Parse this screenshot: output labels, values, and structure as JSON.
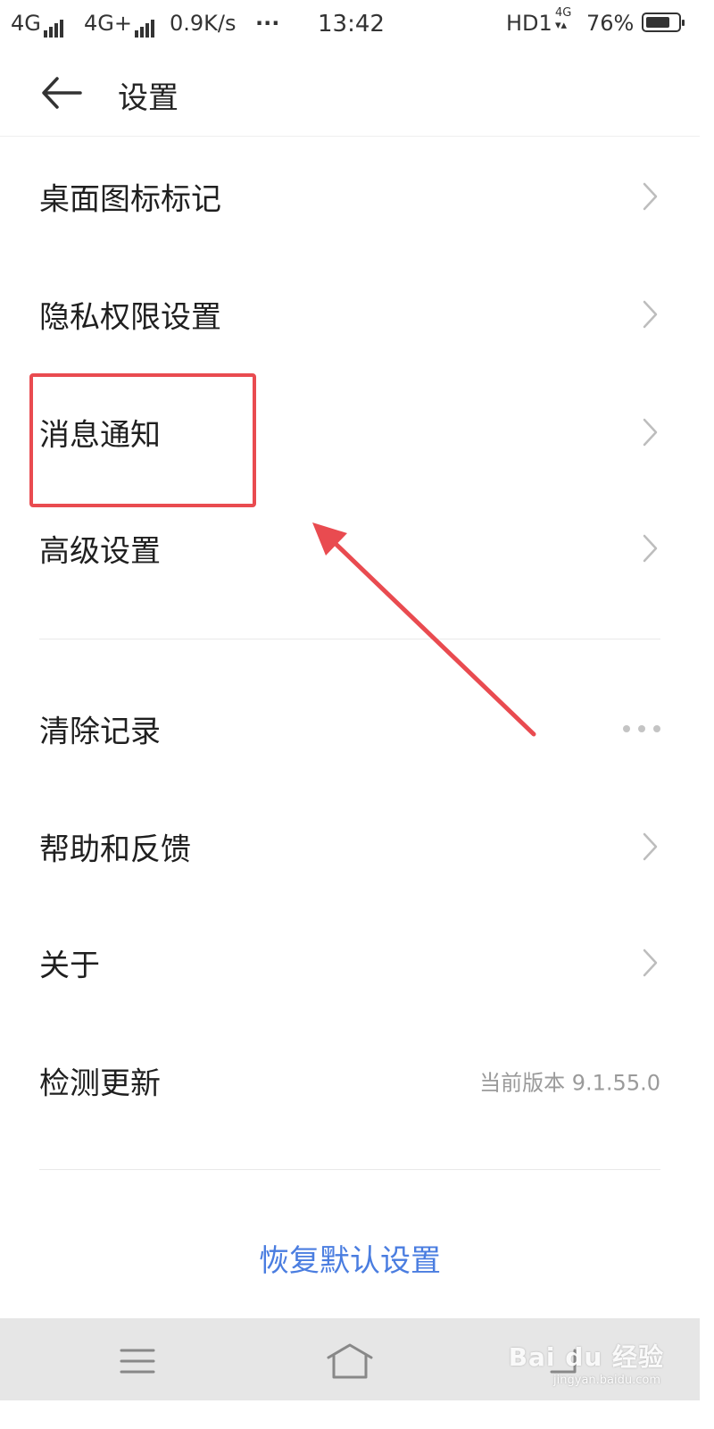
{
  "status_bar": {
    "network1": "4G",
    "network2": "4G+",
    "speed": "0.9K/s",
    "more": "···",
    "time": "13:42",
    "hd": "HD1",
    "lte": "4G",
    "battery": "76%",
    "battery_level": 0.76
  },
  "header": {
    "title": "设置"
  },
  "settings": {
    "desktop_badge": "桌面图标标记",
    "privacy": "隐私权限设置",
    "notifications": "消息通知",
    "advanced": "高级设置",
    "clear_records": "清除记录",
    "help_feedback": "帮助和反馈",
    "about": "关于",
    "check_update": "检测更新",
    "current_version": "当前版本 9.1.55.0"
  },
  "restore_default": "恢复默认设置",
  "watermark": {
    "brand": "Bai du 经验",
    "url": "jingyan.baidu.com"
  },
  "icons": {
    "back": "arrow-left-icon",
    "chevron": "chevron-right-icon",
    "more": "more-dots-icon",
    "nav_menu": "menu-icon",
    "nav_home": "home-icon",
    "nav_back": "back-icon"
  },
  "colors": {
    "accent": "#4a7de0",
    "annotation": "#e94b50",
    "nav_bar": "#e6e6e6"
  }
}
